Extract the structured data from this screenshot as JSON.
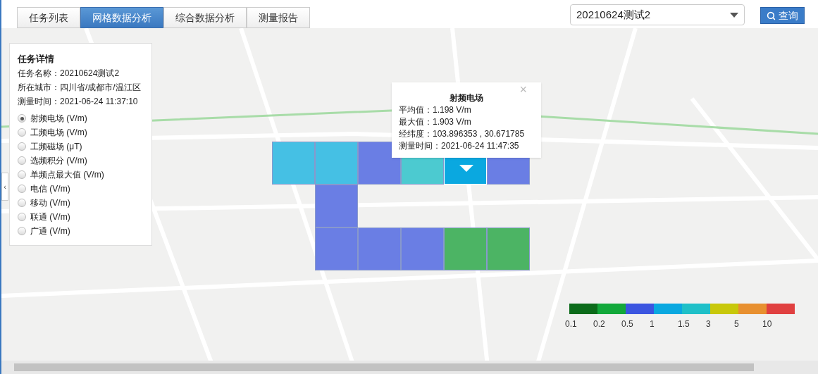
{
  "tabs": [
    {
      "label": "任务列表",
      "selected": false
    },
    {
      "label": "网格数据分析",
      "selected": true
    },
    {
      "label": "综合数据分析",
      "selected": false
    },
    {
      "label": "测量报告",
      "selected": false
    }
  ],
  "task_select": {
    "value": "20210624测试2"
  },
  "query_button": {
    "label": "查询"
  },
  "details": {
    "title": "任务详情",
    "lines": [
      "任务名称：20210624测试2",
      "所在城市：四川省/成都市/温江区",
      "测量时间：2021-06-24 11:37:10"
    ]
  },
  "metrics": [
    {
      "label": "射频电场 (V/m)",
      "selected": true
    },
    {
      "label": "工频电场 (V/m)",
      "selected": false
    },
    {
      "label": "工频磁场 (μT)",
      "selected": false
    },
    {
      "label": "选频积分 (V/m)",
      "selected": false
    },
    {
      "label": "单频点最大值 (V/m)",
      "selected": false
    },
    {
      "label": "电信 (V/m)",
      "selected": false
    },
    {
      "label": "移动 (V/m)",
      "selected": false
    },
    {
      "label": "联通 (V/m)",
      "selected": false
    },
    {
      "label": "广通 (V/m)",
      "selected": false
    }
  ],
  "cells": [
    {
      "color": "#45c0e4",
      "selected": false
    },
    {
      "color": "#45c0e4",
      "selected": false
    },
    {
      "color": "#6a7ee4",
      "selected": false
    },
    {
      "color": "#4ccad0",
      "selected": false
    },
    {
      "color": "#0aa8e0",
      "selected": true
    },
    {
      "color": "#6a7ee4",
      "selected": false
    },
    {
      "color": "#6a7ee4",
      "selected": false
    },
    {
      "color": "#6a7ee4",
      "selected": false
    },
    {
      "color": "#6a7ee4",
      "selected": false
    },
    {
      "color": "#6a7ee4",
      "selected": false
    },
    {
      "color": "#4cb464",
      "selected": false
    },
    {
      "color": "#4cb464",
      "selected": false
    }
  ],
  "popup": {
    "title": "射频电场",
    "close": "×",
    "lines": [
      "平均值：1.198 V/m",
      "最大值：1.903 V/m",
      "经纬度：103.896353 , 30.671785",
      "测量时间：2021-06-24 11:47:35"
    ]
  },
  "legend": {
    "swatches": [
      {
        "color": "#0b6b1a"
      },
      {
        "color": "#12a83a"
      },
      {
        "color": "#3b55e0"
      },
      {
        "color": "#0aa8e0"
      },
      {
        "color": "#1fc0c8"
      },
      {
        "color": "#c8c80a"
      },
      {
        "color": "#e89030"
      },
      {
        "color": "#e04040"
      }
    ],
    "labels": [
      "0.1",
      "0.2",
      "0.5",
      "1",
      "1.5",
      "3",
      "5",
      "10"
    ]
  },
  "collapse": {
    "label": "‹"
  }
}
